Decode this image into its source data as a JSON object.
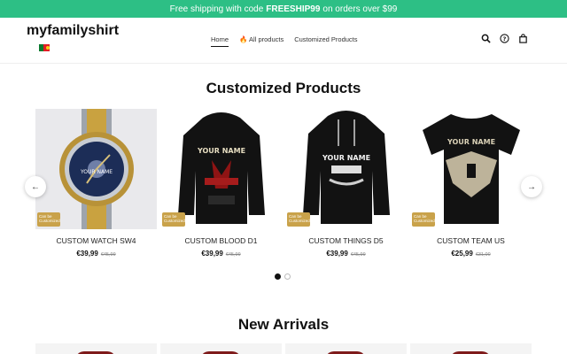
{
  "announcement": {
    "text_before": "Free shipping with code",
    "code": "FREESHIP99",
    "text_after": "on orders over $99"
  },
  "header": {
    "brand": "myfamilyshirt",
    "nav": [
      {
        "label": "Home",
        "active": true
      },
      {
        "label": "🔥 All products",
        "active": false
      },
      {
        "label": "Customized Products",
        "active": false
      }
    ],
    "icons": [
      "search-icon",
      "help-icon",
      "bag-icon"
    ]
  },
  "customized": {
    "title": "Customized Products",
    "products": [
      {
        "name": "CUSTOM WATCH SW4",
        "price": "€39,99",
        "old_price": "€45,99",
        "badge": "Can be Customized",
        "image_text": "YOUR NAME"
      },
      {
        "name": "CUSTOM BLOOD D1",
        "price": "€39,99",
        "old_price": "€45,99",
        "badge": "Can be Customized",
        "image_text": "YOUR NAME"
      },
      {
        "name": "CUSTOM THINGS D5",
        "price": "€39,99",
        "old_price": "€45,99",
        "badge": "Can be Customized",
        "image_text": "YOUR NAME"
      },
      {
        "name": "CUSTOM TEAM US",
        "price": "€25,99",
        "old_price": "€31,00",
        "badge": "Can be Customized",
        "image_text": "YOUR NAME"
      }
    ],
    "prev_arrow": "←",
    "next_arrow": "→",
    "pagination": {
      "pages": 2,
      "current": 1
    }
  },
  "new_arrivals": {
    "title": "New Arrivals"
  },
  "colors": {
    "announce_bg": "#2dbf85",
    "badge": "#c9a24a"
  }
}
